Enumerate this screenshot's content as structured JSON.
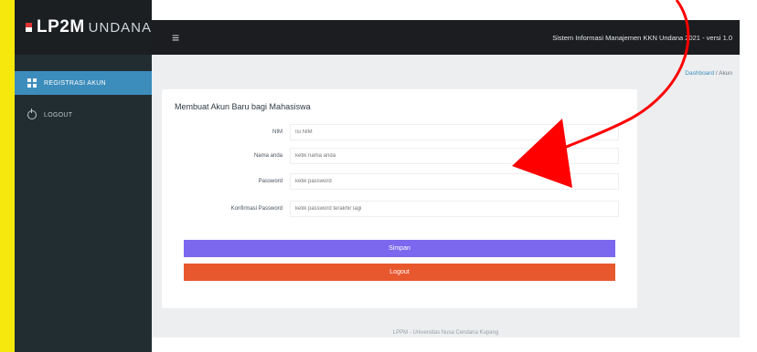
{
  "brand": {
    "name": "LP2M",
    "sub": "UNDANA"
  },
  "topbar": {
    "title": "Sistem Informasi Manajemen KKN Undana 2021 - versi 1.0"
  },
  "sidebar": {
    "items": [
      {
        "label": "REGISTRASI AKUN",
        "icon": "grid-icon"
      },
      {
        "label": "LOGOUT",
        "icon": "power-icon"
      }
    ]
  },
  "breadcrumb": {
    "home": "Dashboard",
    "sep": "/",
    "current": "Akun"
  },
  "form": {
    "title": "Membuat Akun Baru bagi Mahasiswa",
    "fields": [
      {
        "label": "NIM",
        "placeholder": "Isi NIM"
      },
      {
        "label": "Nama anda",
        "placeholder": "ketik nama anda"
      },
      {
        "label": "Password",
        "placeholder": "ketik password"
      },
      {
        "label": "Konfirmasi Password",
        "placeholder": "ketik password terakhir lagi"
      }
    ],
    "save_label": "Simpan",
    "cancel_label": "Logout"
  },
  "footer": {
    "text": "LPPM - Universitas Nusa Cendana Kupang"
  },
  "colors": {
    "accent": "#3c8dbc",
    "save": "#7b68ee",
    "cancel": "#e8582e",
    "arrow": "#ff0000",
    "highlight": "#f6e80c"
  }
}
